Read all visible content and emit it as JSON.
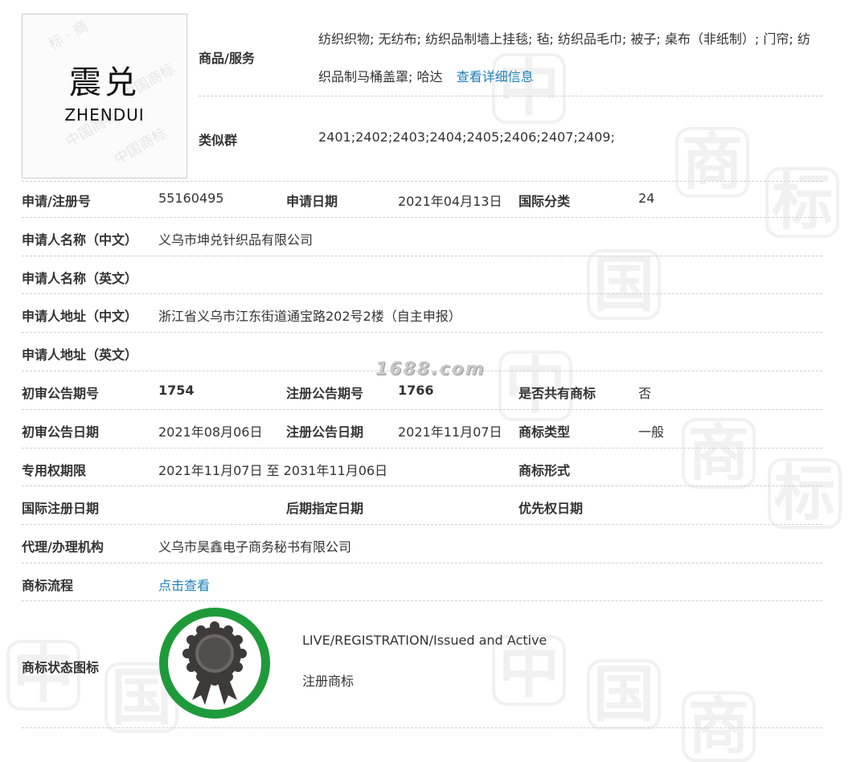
{
  "logo": {
    "name_cn": "震兑",
    "name_en": "ZHENDUI"
  },
  "goods": {
    "label": "商品/服务",
    "line1": "纺织织物; 无纺布; 纺织品制墙上挂毯; 毡; 纺织品毛巾; 被子; 桌布（非纸制）; 门帘; 纺",
    "line2": "织品制马桶盖罩; 哈达",
    "detail_link": "查看详细信息"
  },
  "similar": {
    "label": "类似群",
    "value": "2401;2402;2403;2404;2405;2406;2407;2409;"
  },
  "reg_no": {
    "label": "申请/注册号",
    "value": "55160495"
  },
  "app_date": {
    "label": "申请日期",
    "value": "2021年04月13日"
  },
  "intl_class": {
    "label": "国际分类",
    "value": "24"
  },
  "applicant_cn": {
    "label": "申请人名称（中文）",
    "value": "义乌市坤兑针织品有限公司"
  },
  "applicant_en": {
    "label": "申请人名称（英文）",
    "value": ""
  },
  "address_cn": {
    "label": "申请人地址（中文）",
    "value": "浙江省义乌市江东街道通宝路202号2楼（自主申报）"
  },
  "address_en": {
    "label": "申请人地址（英文）",
    "value": ""
  },
  "prelim_no": {
    "label": "初审公告期号",
    "value": "1754"
  },
  "reg_pub_no": {
    "label": "注册公告期号",
    "value": "1766"
  },
  "shared": {
    "label": "是否共有商标",
    "value": "否"
  },
  "prelim_date": {
    "label": "初审公告日期",
    "value": "2021年08月06日"
  },
  "reg_pub_date": {
    "label": "注册公告日期",
    "value": "2021年11月07日"
  },
  "tm_type": {
    "label": "商标类型",
    "value": "一般"
  },
  "exclusive": {
    "label": "专用权期限",
    "value": "2021年11月07日 至 2031年11月06日"
  },
  "tm_form": {
    "label": "商标形式",
    "value": ""
  },
  "intl_reg_date": {
    "label": "国际注册日期",
    "value": ""
  },
  "later_date": {
    "label": "后期指定日期",
    "value": ""
  },
  "priority_date": {
    "label": "优先权日期",
    "value": ""
  },
  "agent": {
    "label": "代理/办理机构",
    "value": "义乌市昊鑫电子商务秘书有限公司"
  },
  "process": {
    "label": "商标流程",
    "link": "点击查看"
  },
  "status": {
    "label": "商标状态图标",
    "line1": "LIVE/REGISTRATION/Issued and Active",
    "line2": "注册商标"
  },
  "site_watermark": "1688.com",
  "watermark_chars": [
    "中",
    "国",
    "商",
    "标"
  ],
  "colors": {
    "link": "#1e7fb8",
    "seal_ring": "#1f9a3a",
    "seal_badge": "#3d3a38"
  }
}
